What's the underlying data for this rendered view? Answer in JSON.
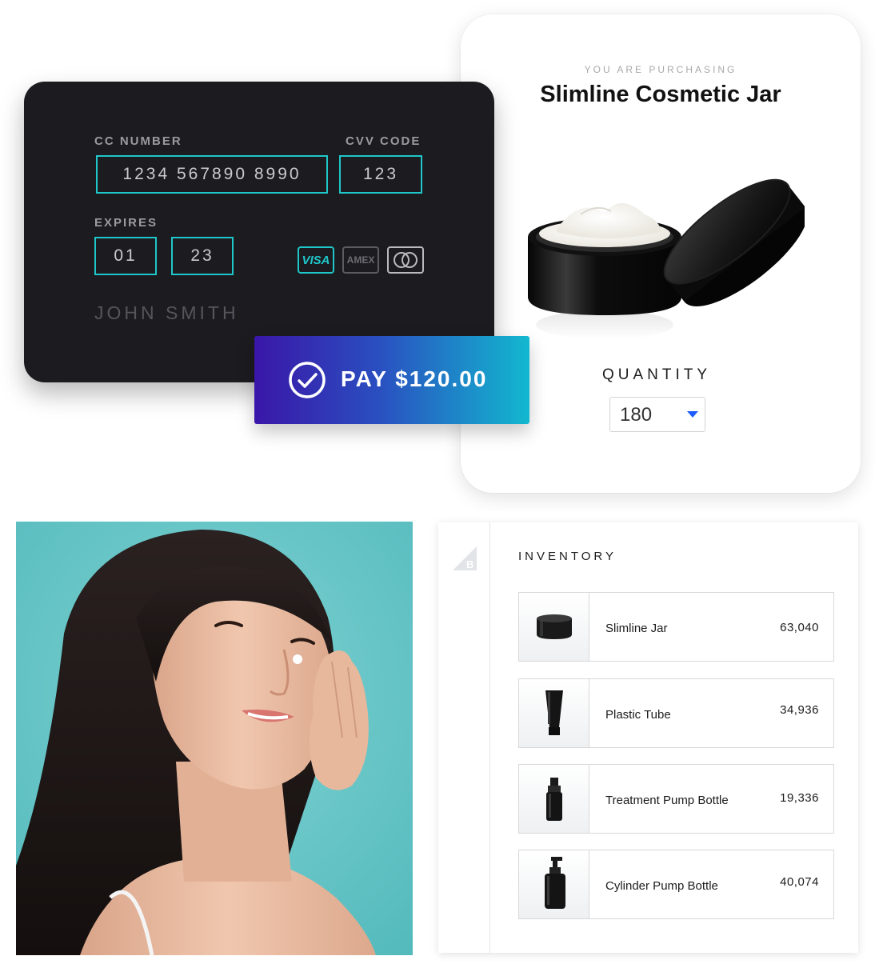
{
  "product": {
    "eyebrow": "YOU ARE PURCHASING",
    "title": "Slimline Cosmetic Jar",
    "quantity_label": "QUANTITY",
    "quantity_value": "180"
  },
  "payment": {
    "cc_number_label": "CC NUMBER",
    "cc_number_value": "1234 567890 8990",
    "cvv_label": "CVV CODE",
    "cvv_value": "123",
    "expires_label": "EXPIRES",
    "expires_month": "01",
    "expires_year": "23",
    "cardholder_name": "JOHN SMITH",
    "brands": [
      "VISA",
      "AMEX",
      "mastercard"
    ],
    "pay_label": "PAY $120.00"
  },
  "inventory": {
    "title": "INVENTORY",
    "items": [
      {
        "name": "Slimline Jar",
        "count": "63,040",
        "icon": "jar-thumbnail"
      },
      {
        "name": "Plastic Tube",
        "count": "34,936",
        "icon": "tube-thumbnail"
      },
      {
        "name": "Treatment Pump Bottle",
        "count": "19,336",
        "icon": "treatment-pump-thumbnail"
      },
      {
        "name": "Cylinder Pump Bottle",
        "count": "40,074",
        "icon": "cylinder-pump-thumbnail"
      }
    ]
  },
  "colors": {
    "accent_teal": "#1fc7c9",
    "card_dark": "#1b1b20",
    "pay_gradient_start": "#3a16a8",
    "pay_gradient_end": "#12b8cf",
    "select_caret": "#1f5cff",
    "photo_background": "#6cc8c9"
  }
}
